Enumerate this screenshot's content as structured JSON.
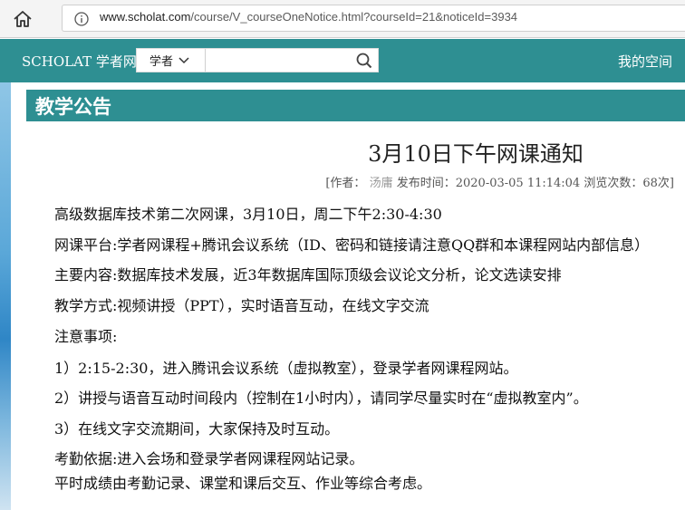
{
  "browser": {
    "url_domain": "www.scholat.com",
    "url_path": "/course/V_courseOneNotice.html?courseId=21&noticeId=3934"
  },
  "header": {
    "brand": "SCHOLAT 学者网",
    "search_type": "学者",
    "search_value": "",
    "my_space": "我的空间"
  },
  "panel": {
    "title": "教学公告"
  },
  "notice": {
    "title": "3月10日下午网课通知",
    "meta_prefix": "[作者：",
    "author": "汤庸",
    "publish_label": "发布时间：",
    "publish_time": "2020-03-05 11:14:04",
    "views_label": "浏览次数：",
    "views": "68",
    "meta_suffix": "次]",
    "lines": [
      "高级数据库技术第二次网课，3月10日，周二下午2:30-4:30",
      "网课平台:学者网课程+腾讯会议系统（ID、密码和链接请注意QQ群和本课程网站内部信息）",
      "主要内容:数据库技术发展，近3年数据库国际顶级会议论文分析，论文选读安排",
      "教学方式:视频讲授（PPT），实时语音互动，在线文字交流",
      "注意事项:",
      "1）2:15-2:30，进入腾讯会议系统（虚拟教室），登录学者网课程网站。",
      "2）讲授与语音互动时间段内（控制在1小时内），请同学尽量实时在“虚拟教室内”。",
      "3）在线文字交流期间，大家保持及时互动。",
      "考勤依据:进入会场和登录学者网课程网站记录。",
      "平时成绩由考勤记录、课堂和课后交互、作业等综合考虑。"
    ]
  },
  "colors": {
    "header_bg": "#2e8f92",
    "panel_title_bg": "#2e8f92"
  }
}
